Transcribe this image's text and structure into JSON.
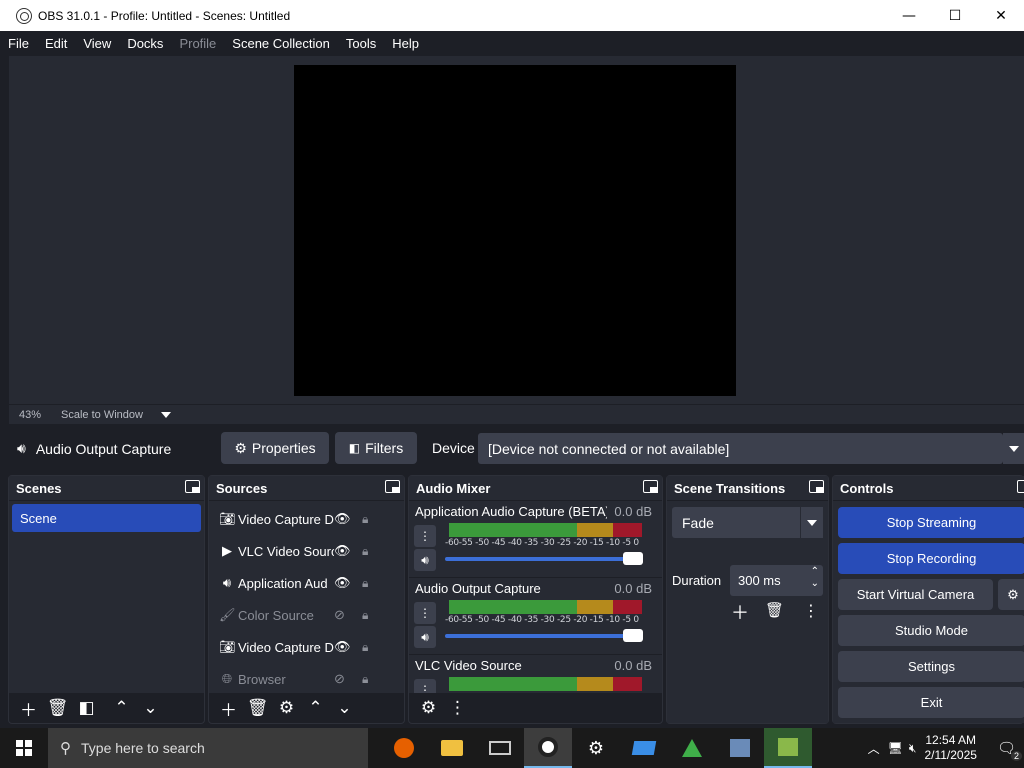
{
  "window": {
    "title": "OBS 31.0.1 - Profile: Untitled - Scenes: Untitled",
    "min": "—",
    "max": "☐",
    "close": "✕"
  },
  "menu": [
    "File",
    "Edit",
    "View",
    "Docks",
    "Profile",
    "Scene Collection",
    "Tools",
    "Help"
  ],
  "preview": {
    "zoom": "43%",
    "scale_mode": "Scale to Window"
  },
  "context": {
    "source_name": "Audio Output Capture",
    "properties_label": "Properties",
    "filters_label": "Filters",
    "device_label": "Device",
    "device_value": "[Device not connected or not available]"
  },
  "scenes": {
    "title": "Scenes",
    "items": [
      "Scene"
    ]
  },
  "sources": {
    "title": "Sources",
    "items": [
      {
        "name": "Video Capture D",
        "icon": "camera-icon",
        "visible": true
      },
      {
        "name": "VLC Video Sourc",
        "icon": "play-icon",
        "visible": true
      },
      {
        "name": "Application Aud",
        "icon": "speaker-icon",
        "visible": true
      },
      {
        "name": "Color Source",
        "icon": "brush-icon",
        "visible": false
      },
      {
        "name": "Video Capture D",
        "icon": "camera-icon",
        "visible": true
      },
      {
        "name": "Browser",
        "icon": "globe-icon",
        "visible": false
      }
    ]
  },
  "mixer": {
    "title": "Audio Mixer",
    "ticks": "-60-55 -50 -45 -40 -35 -30 -25 -20 -15 -10 -5  0",
    "channels": [
      {
        "name": "Application Audio Capture (BETA)",
        "db": "0.0 dB",
        "volume": 1.0
      },
      {
        "name": "Audio Output Capture",
        "db": "0.0 dB",
        "volume": 1.0
      },
      {
        "name": "VLC Video Source",
        "db": "0.0 dB",
        "volume": 1.0
      }
    ]
  },
  "transitions": {
    "title": "Scene Transitions",
    "selected": "Fade",
    "duration_label": "Duration",
    "duration_value": "300 ms"
  },
  "controls": {
    "title": "Controls",
    "stop_streaming": "Stop Streaming",
    "stop_recording": "Stop Recording",
    "start_virtual_camera": "Start Virtual Camera",
    "studio_mode": "Studio Mode",
    "settings": "Settings",
    "exit": "Exit"
  },
  "taskbar": {
    "search_placeholder": "Type here to search",
    "time": "12:54 AM",
    "date": "2/11/2025",
    "notification_count": "2"
  }
}
